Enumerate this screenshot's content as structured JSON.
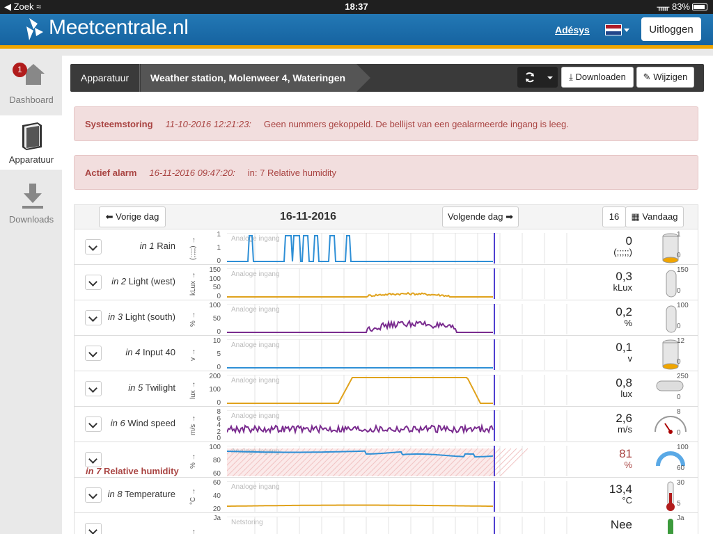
{
  "status": {
    "left": "Zoek",
    "time": "18:37",
    "battery": "83%"
  },
  "header": {
    "brand": "Meetcentrale.nl",
    "user": "Adésys",
    "logout": "Uitloggen"
  },
  "sidebar": [
    {
      "label": "Dashboard",
      "badge": "1"
    },
    {
      "label": "Apparatuur"
    },
    {
      "label": "Downloads"
    }
  ],
  "breadcrumb": {
    "section": "Apparatuur",
    "device": "Weather station, Molenweer 4, Wateringen",
    "download": "Downloaden",
    "edit": "Wijzigen"
  },
  "alerts": [
    {
      "title": "Systeemstoring",
      "time": "11-10-2016 12:21:23:",
      "message": "Geen nummers gekoppeld. De bellijst van een gealarmeerde ingang is leeg."
    },
    {
      "title": "Actief alarm",
      "time": "16-11-2016 09:47:20:",
      "message": "in: 7 Relative humidity"
    }
  ],
  "day": {
    "prev": "Vorige dag",
    "date": "16-11-2016",
    "next": "Volgende dag",
    "day_number": "16",
    "today": "Vandaag"
  },
  "rows": [
    {
      "prefix": "in 1",
      "name": "Rain",
      "unit": "(;;;;;)",
      "ticks": [
        "1",
        "1",
        "0"
      ],
      "chart_label": "Analoge ingang",
      "value": "0",
      "value_unit": "(;;;;;)",
      "gauge_max": "1",
      "gauge_min": "0",
      "color": "#2e8fd6",
      "alarm": false
    },
    {
      "prefix": "in 2",
      "name": "Light (west)",
      "unit": "kLux",
      "ticks": [
        "150",
        "100",
        "50",
        "0"
      ],
      "chart_label": "Analoge ingang",
      "value": "0,3",
      "value_unit": "kLux",
      "gauge_max": "150",
      "gauge_min": "0",
      "color": "#e0a21c",
      "alarm": false
    },
    {
      "prefix": "in 3",
      "name": "Light (south)",
      "unit": "%",
      "ticks": [
        "100",
        "50",
        "0"
      ],
      "chart_label": "Analoge ingang",
      "value": "0,2",
      "value_unit": "%",
      "gauge_max": "100",
      "gauge_min": "0",
      "color": "#7a2c8f",
      "alarm": false
    },
    {
      "prefix": "in 4",
      "name": "Input 40",
      "unit": "v",
      "ticks": [
        "10",
        "5",
        "0"
      ],
      "chart_label": "Analoge ingang",
      "value": "0,1",
      "value_unit": "v",
      "gauge_max": "12",
      "gauge_min": "0",
      "color": "#2e8fd6",
      "alarm": false
    },
    {
      "prefix": "in 5",
      "name": "Twilight",
      "unit": "lux",
      "ticks": [
        "200",
        "100",
        "0"
      ],
      "chart_label": "Analoge ingang",
      "value": "0,8",
      "value_unit": "lux",
      "gauge_max": "250",
      "gauge_min": "0",
      "color": "#e0a21c",
      "alarm": false
    },
    {
      "prefix": "in 6",
      "name": "Wind speed",
      "unit": "m/s",
      "ticks": [
        "8",
        "6",
        "4",
        "2",
        "0"
      ],
      "chart_label": "Analoge ingang",
      "value": "2,6",
      "value_unit": "m/s",
      "gauge_max": "8",
      "gauge_min": "0",
      "color": "#7a2c8f",
      "alarm": false
    },
    {
      "prefix": "in 7",
      "name": "Relative humidity",
      "unit": "%",
      "ticks": [
        "100",
        "80",
        "60"
      ],
      "chart_label": "Analoge ingang",
      "value": "81",
      "value_unit": "%",
      "gauge_max": "100",
      "gauge_min": "60",
      "color": "#2e8fd6",
      "alarm": true
    },
    {
      "prefix": "in 8",
      "name": "Temperature",
      "unit": "°C",
      "ticks": [
        "60",
        "40",
        "20"
      ],
      "chart_label": "Analoge ingang",
      "value": "13,4",
      "value_unit": "°C",
      "gauge_max": "30",
      "gauge_min": "5",
      "color": "#e0a21c",
      "alarm": false
    },
    {
      "prefix": "",
      "name": "",
      "unit": "",
      "ticks": [
        "Ja"
      ],
      "chart_label": "Netstoring",
      "value": "Nee",
      "value_unit": "",
      "gauge_max": "Ja",
      "gauge_min": "",
      "color": "#2e8fd6",
      "alarm": false
    }
  ]
}
